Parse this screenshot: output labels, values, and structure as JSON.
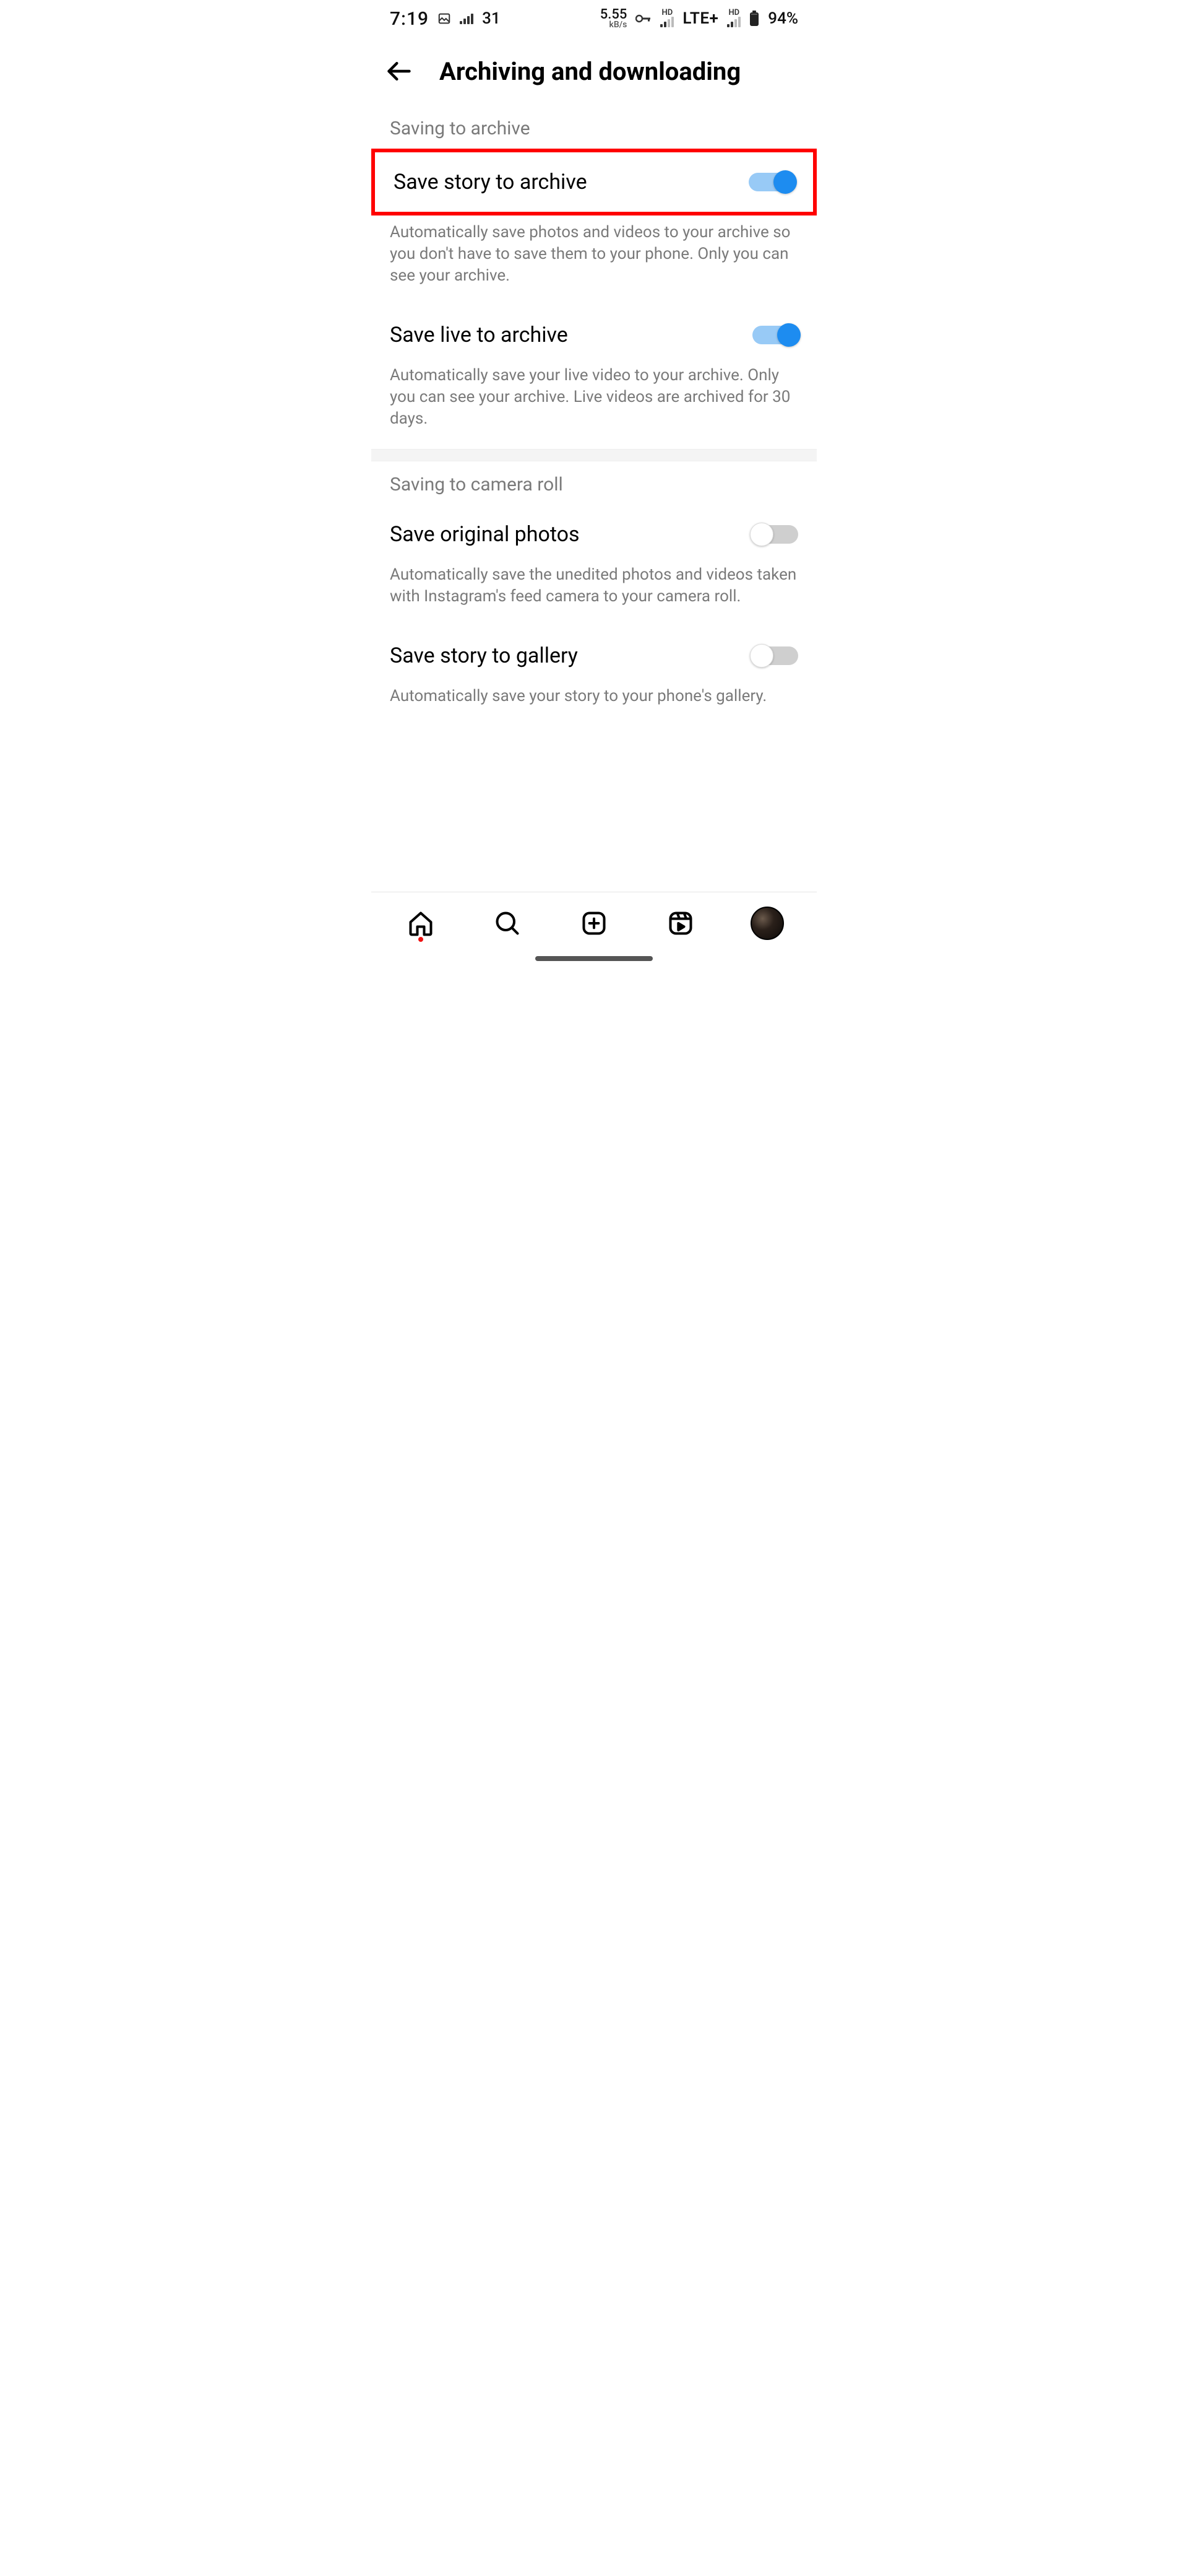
{
  "status": {
    "time": "7:19",
    "temp": "31",
    "net_rate_value": "5.55",
    "net_rate_unit": "kB/s",
    "hd_label": "HD",
    "network_type": "LTE+",
    "battery": "94%"
  },
  "header": {
    "title": "Archiving and downloading"
  },
  "sections": {
    "archive": {
      "label": "Saving to archive",
      "items": [
        {
          "title": "Save story to archive",
          "desc": "Automatically save photos and videos to your archive so you don't have to save them to your phone. Only you can see your archive.",
          "on": true,
          "highlighted": true
        },
        {
          "title": "Save live to archive",
          "desc": "Automatically save your live video to your archive. Only you can see your archive. Live videos are archived for 30 days.",
          "on": true,
          "highlighted": false
        }
      ]
    },
    "camera_roll": {
      "label": "Saving to camera roll",
      "items": [
        {
          "title": "Save original photos",
          "desc": "Automatically save the unedited photos and videos taken with Instagram's feed camera to your camera roll.",
          "on": false
        },
        {
          "title": "Save story to gallery",
          "desc": "Automatically save your story to your phone's gallery.",
          "on": false
        }
      ]
    }
  }
}
